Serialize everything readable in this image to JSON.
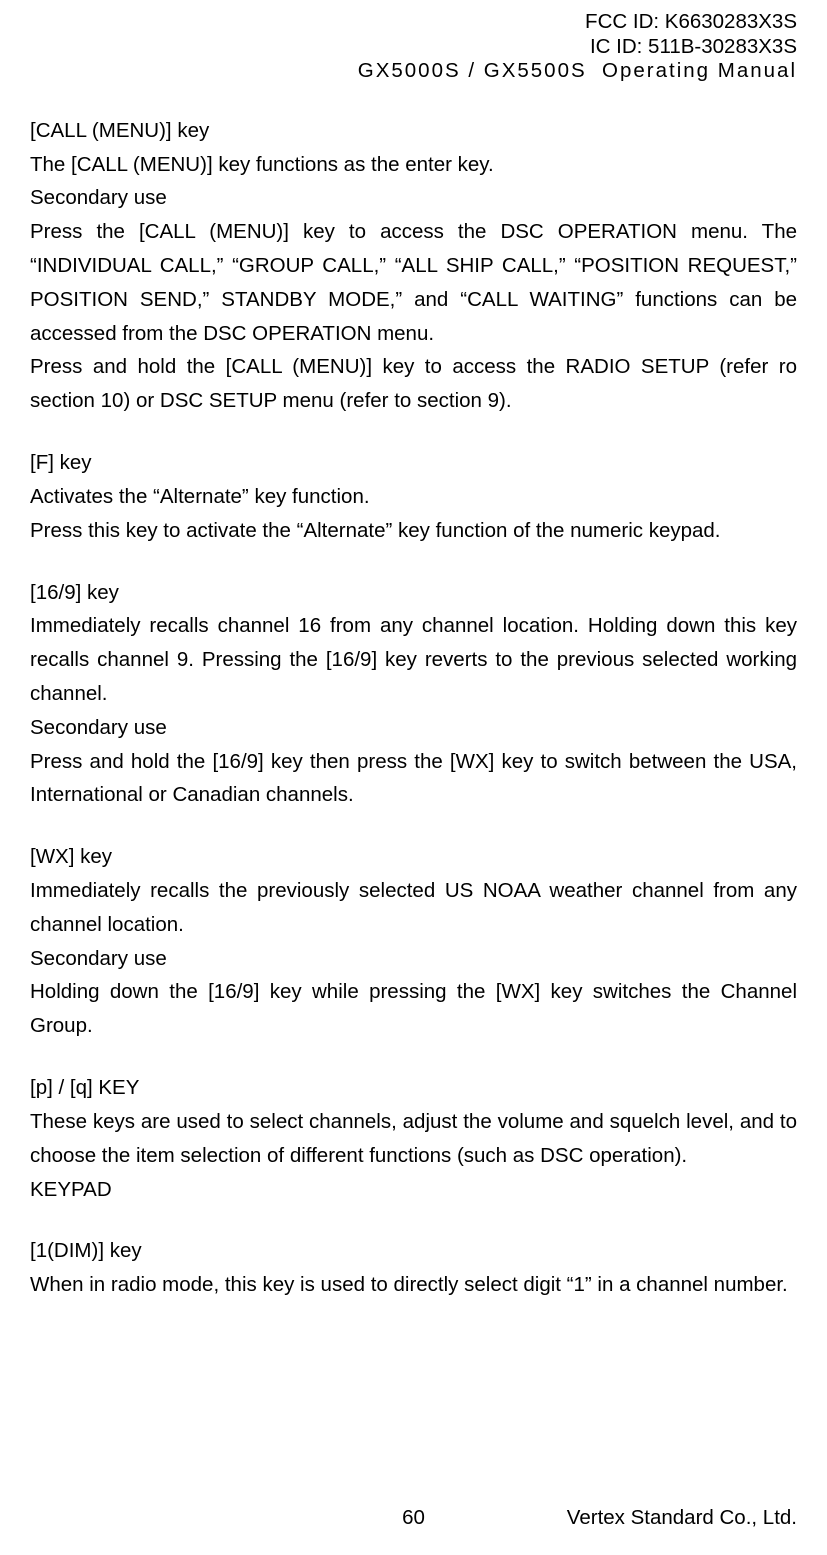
{
  "header": {
    "fcc": "FCC ID: K6630283X3S",
    "ic": "IC ID: 511B-30283X3S",
    "model": "GX5000S / GX5500S  Operating Manual"
  },
  "sections": {
    "call_menu": {
      "title": "[CALL (MENU)] key",
      "line1": "The [CALL (MENU)] key functions as the enter key.",
      "sub": "Secondary use",
      "para1": "Press the [CALL (MENU)] key to access the DSC OPERATION menu. The “INDIVIDUAL CALL,” “GROUP CALL,” “ALL SHIP CALL,” “POSITION REQUEST,” POSITION SEND,” STANDBY MODE,” and “CALL WAITING” functions can be accessed from the DSC OPERATION menu.",
      "para2": "Press and hold the [CALL (MENU)] key to access the RADIO SETUP (refer ro section 10) or DSC SETUP menu (refer to section 9)."
    },
    "f_key": {
      "title": "[F] key",
      "line1": "Activates the “Alternate” key function.",
      "line2": "Press this key to activate the “Alternate” key function of the numeric keypad."
    },
    "k169": {
      "title": "[16/9] key",
      "para1": "Immediately recalls channel 16 from any channel location. Holding down this key recalls channel 9. Pressing the [16/9] key reverts to the previous selected working channel.",
      "sub": "Secondary use",
      "para2": "Press and hold the [16/9] key then press the [WX] key to switch between the USA, International or Canadian channels."
    },
    "wx": {
      "title": "[WX] key",
      "para1": "Immediately recalls the previously selected US NOAA weather channel from any channel location.",
      "sub": "Secondary use",
      "para2": "Holding down the [16/9] key while pressing the [WX] key switches the Channel Group."
    },
    "pq": {
      "title": "[p] / [q] KEY",
      "para1": "These keys are used to select channels, adjust the volume and squelch level, and to choose the item selection of different functions (such as DSC operation).",
      "keypad": "KEYPAD"
    },
    "dim": {
      "title": "[1(DIM)] key",
      "line1": "When in radio mode, this key is used to directly select digit “1” in a channel number."
    }
  },
  "footer": {
    "page": "60",
    "company": "Vertex Standard Co., Ltd."
  }
}
